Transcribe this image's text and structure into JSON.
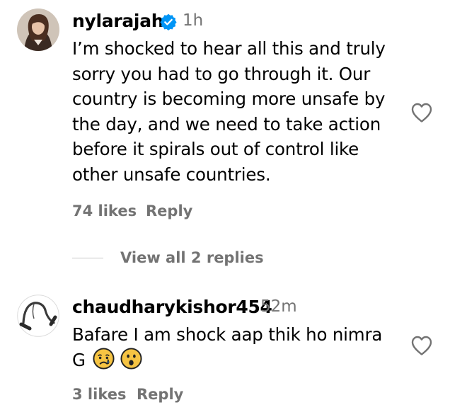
{
  "comments": [
    {
      "username": "nylarajah",
      "verified": true,
      "time": "1h",
      "text": "I’m shocked to hear all this and truly\nsorry you had to go through it. Our\ncountry is becoming more unsafe by\nthe day, and we need to take action\nbefore it spirals out of control like\nother unsafe countries.",
      "likes": "74 likes",
      "reply_label": "Reply",
      "view_replies": "View all 2 replies"
    },
    {
      "username": "chaudharykishor454",
      "verified": false,
      "time": "52m",
      "text": "Bafare I am shock aap thik ho nimra\nG",
      "emojis": [
        "crying-face",
        "face-with-open-mouth"
      ],
      "likes": "3 likes",
      "reply_label": "Reply"
    }
  ],
  "colors": {
    "text": "#000000",
    "secondary": "#737373",
    "verified_blue": "#0095f6",
    "divider": "#c7c7c7"
  },
  "icons": [
    "verified-badge-icon",
    "heart-icon"
  ]
}
